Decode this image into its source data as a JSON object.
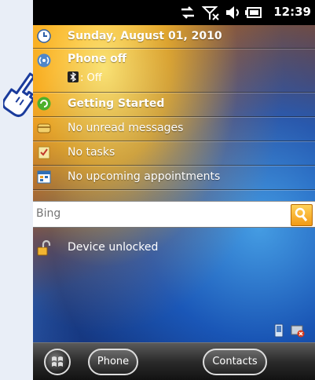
{
  "status": {
    "time": "12:39"
  },
  "today": {
    "date": "Sunday, August 01, 2010",
    "phone": {
      "title": "Phone off",
      "bluetooth_value": ": Off"
    },
    "getting_started": "Getting Started",
    "messages": "No unread messages",
    "tasks": "No tasks",
    "appointments": "No upcoming appointments"
  },
  "search": {
    "placeholder": "Bing"
  },
  "lock": {
    "label": "Device unlocked"
  },
  "softkeys": {
    "left": "Phone",
    "right": "Contacts"
  },
  "colors": {
    "accent_orange": "#f39a15",
    "status_bar": "#000000",
    "wallpaper_blue": "#1b3b87"
  }
}
